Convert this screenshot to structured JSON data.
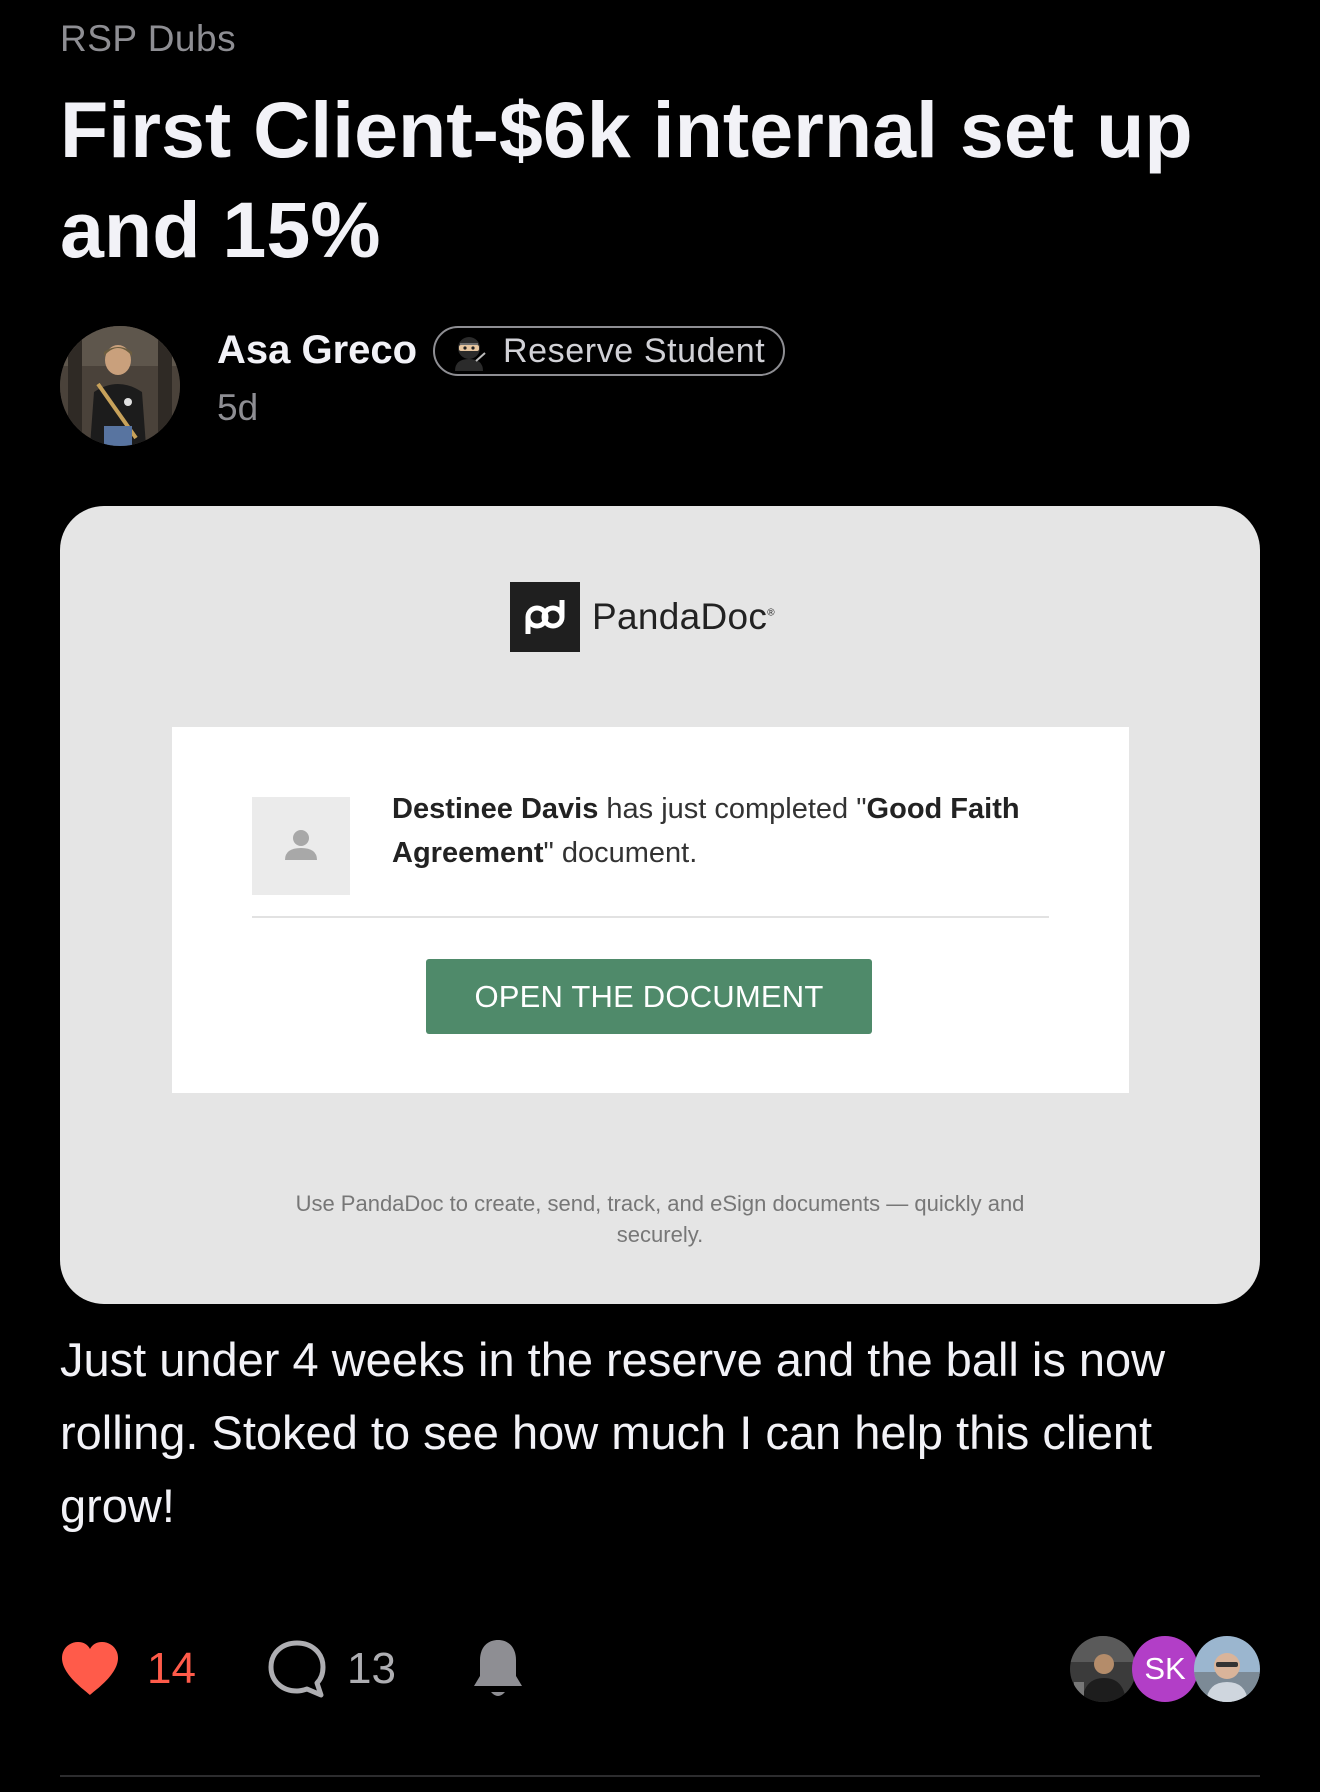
{
  "post": {
    "community": "RSP Dubs",
    "title": "First Client-$6k internal set up and 15%",
    "author": {
      "name": "Asa Greco",
      "role_badge": "Reserve Student",
      "role_icon": "ninja-icon",
      "timestamp": "5d"
    },
    "attachment": {
      "brand": "PandaDoc",
      "notice": {
        "signer": "Destinee Davis",
        "text_part1": " has just completed \"",
        "doc_name": "Good Faith Agreement",
        "text_part2": "\" document."
      },
      "button_label": "OPEN THE DOCUMENT",
      "button_color": "#4f8a6a",
      "footer": "Use PandaDoc to create, send, track, and eSign documents — quickly and securely."
    },
    "body": "Just under 4 weeks in the reserve and the ball is now rolling. Stoked to see how much I can help this client grow!",
    "reactions": {
      "likes": "14",
      "comments": "13",
      "like_color": "#ff5b4a"
    },
    "participants": [
      {
        "type": "photo"
      },
      {
        "type": "initials",
        "initials": "SK",
        "color": "#b23ec7"
      },
      {
        "type": "photo"
      }
    ]
  }
}
